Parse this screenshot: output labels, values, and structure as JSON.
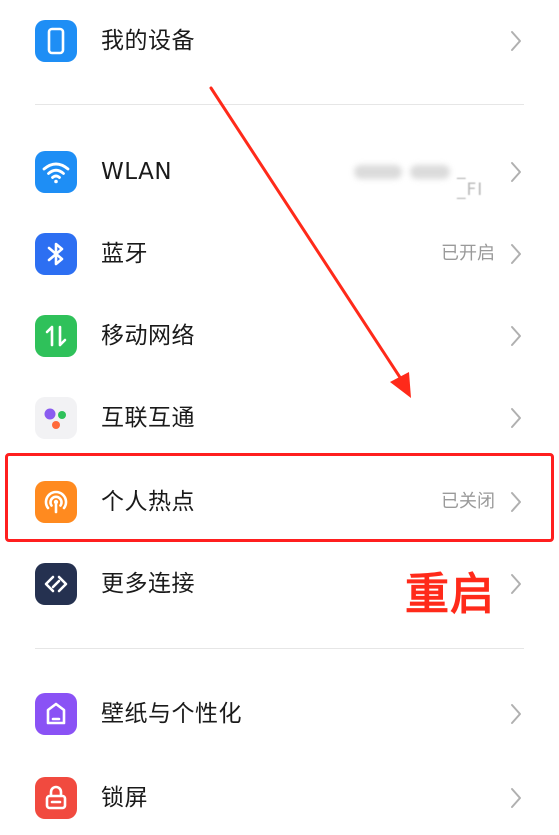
{
  "settings": {
    "items": [
      {
        "label": "我的设备",
        "value": "",
        "icon": "phone-icon"
      },
      {
        "label": "WLAN",
        "value": "_ _FI",
        "icon": "wifi-icon"
      },
      {
        "label": "蓝牙",
        "value": "已开启",
        "icon": "bluetooth-icon"
      },
      {
        "label": "移动网络",
        "value": "",
        "icon": "mobile-data-icon"
      },
      {
        "label": "互联互通",
        "value": "",
        "icon": "interconnect-icon"
      },
      {
        "label": "个人热点",
        "value": "已关闭",
        "icon": "hotspot-icon"
      },
      {
        "label": "更多连接",
        "value": "",
        "icon": "more-connections-icon"
      },
      {
        "label": "壁纸与个性化",
        "value": "",
        "icon": "wallpaper-icon"
      },
      {
        "label": "锁屏",
        "value": "",
        "icon": "lock-icon"
      }
    ]
  },
  "annotation": {
    "text": "重启",
    "color": "#ff2a1a"
  },
  "colors": {
    "phone": "#1e8ef5",
    "wifi": "#1e8ef5",
    "bluetooth": "#2d6ff2",
    "mobile": "#2fc15a",
    "interconnect_bg": "#f2f2f4",
    "hotspot": "#ff8a1f",
    "more_connections": "#253150",
    "wallpaper": "#8a52f5",
    "lock": "#f14a3f",
    "highlight": "#ff1f1f"
  }
}
